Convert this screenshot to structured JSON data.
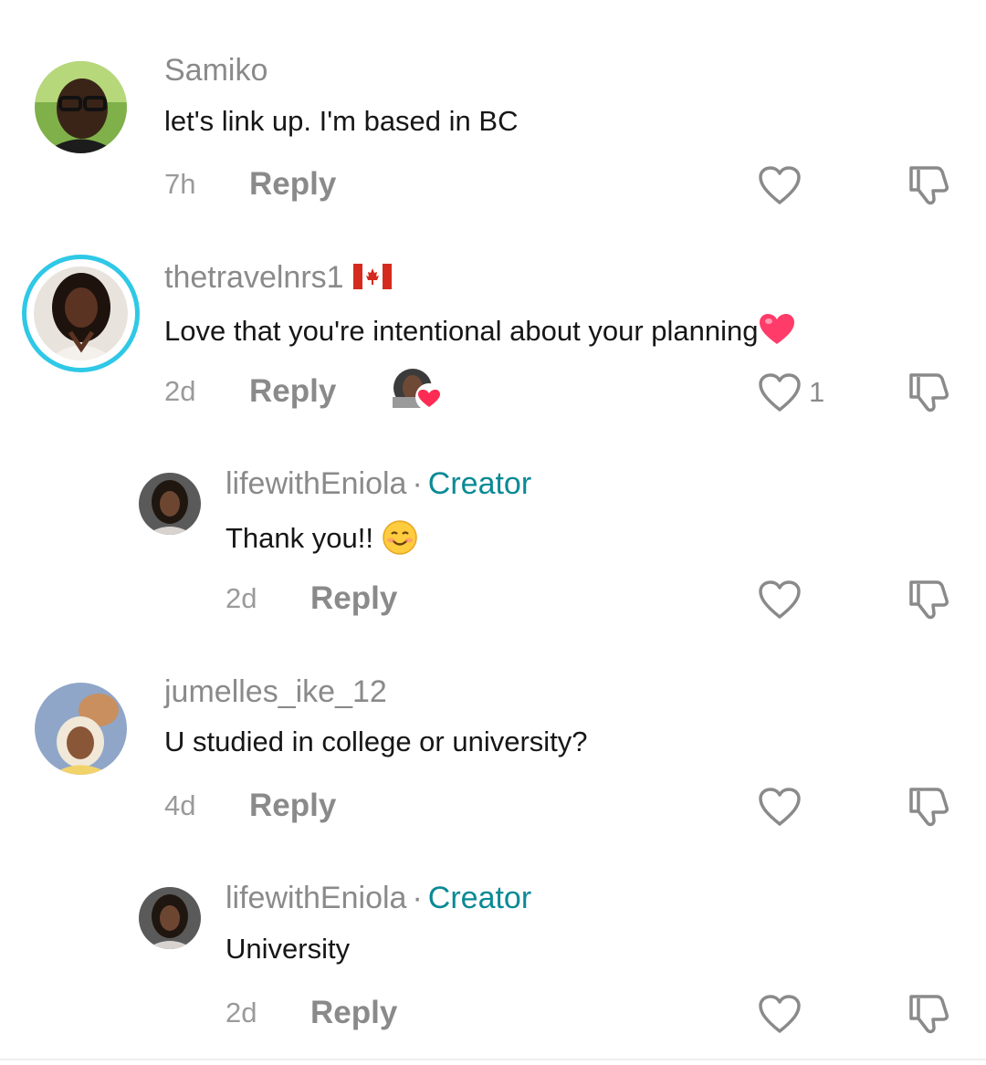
{
  "comments": [
    {
      "username": "Samiko",
      "text": "let's link up. I'm based in BC",
      "time": "7h",
      "reply_label": "Reply",
      "like_count": ""
    },
    {
      "username": "thetravelnrs1",
      "flag_icon": "canada-flag-icon",
      "text": "Love that you're intentional about your planning",
      "text_emoji": "heart-emoji-icon",
      "time": "2d",
      "reply_label": "Reply",
      "like_count": "1",
      "liked_by_creator": true
    },
    {
      "username": "lifewithEniola",
      "separator": "·",
      "badge": "Creator",
      "text": "Thank you!!",
      "text_emoji": "smiling-face-emoji-icon",
      "time": "2d",
      "reply_label": "Reply",
      "like_count": ""
    },
    {
      "username": "jumelles_ike_12",
      "text": "U studied in college or university?",
      "time": "4d",
      "reply_label": "Reply",
      "like_count": ""
    },
    {
      "username": "lifewithEniola",
      "separator": "·",
      "badge": "Creator",
      "text": "University",
      "time": "2d",
      "reply_label": "Reply",
      "like_count": ""
    }
  ],
  "colors": {
    "creator_badge": "#0a8a95",
    "username": "#8a8a8a",
    "text": "#161616",
    "story_ring": "#2fc8e6",
    "heart_red": "#fe2c55"
  }
}
